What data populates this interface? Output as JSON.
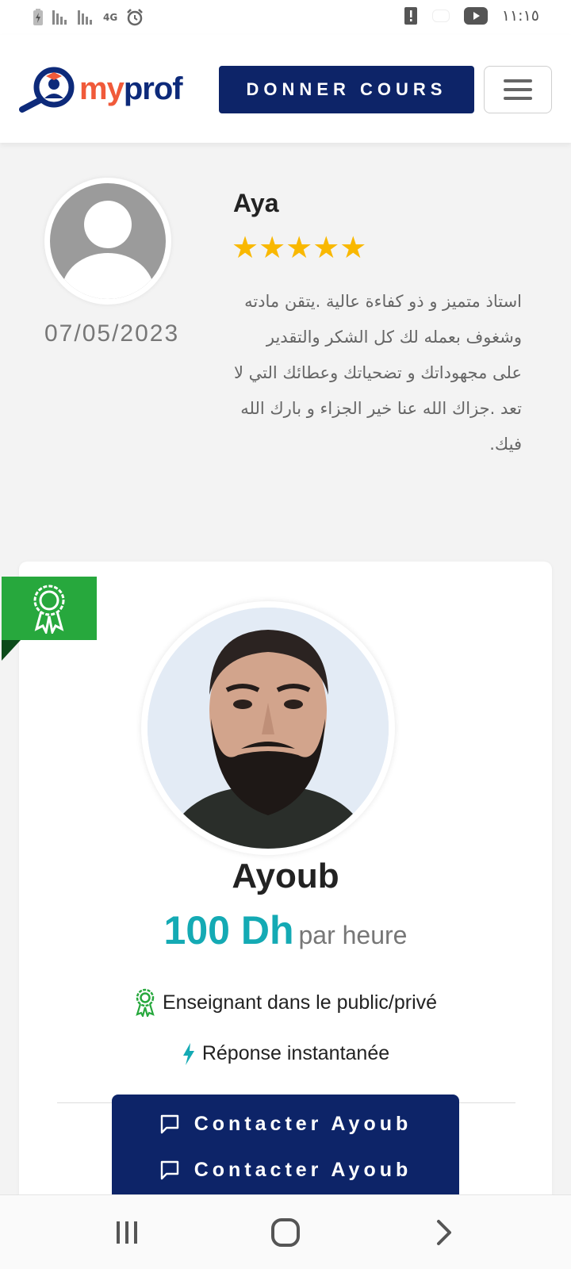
{
  "status_bar": {
    "time": "١١:١٥",
    "network": "4G",
    "icons": [
      "battery-charging-icon",
      "signal-icon",
      "signal-icon",
      "alarm-icon",
      "alert-icon",
      "youtube-icon"
    ]
  },
  "header": {
    "logo_my": "my",
    "logo_prof": "prof",
    "cta_label": "DONNER COURS",
    "menu_icon": "hamburger-icon"
  },
  "review": {
    "name": "Aya",
    "rating": 5,
    "stars": "★★★★★",
    "date": "07/05/2023",
    "text": "استاذ متميز و ذو كفاءة عالية .يتقن مادته وشغوف بعمله لك كل الشكر والتقدير على مجهوداتك و تضحياتك وعطائك التي لا تعد .جزاك الله عنا خير الجزاء و بارك الله فيك."
  },
  "tutor": {
    "name": "Ayoub",
    "price": "100 Dh",
    "price_unit": "par heure",
    "badge_icon": "award-ribbon-icon",
    "features": [
      {
        "icon": "award-icon",
        "label": "Enseignant dans le public/privé"
      },
      {
        "icon": "lightning-icon",
        "label": "Réponse instantanée"
      }
    ],
    "contact_buttons": [
      {
        "icon": "chat-icon",
        "label": "Contacter Ayoub"
      },
      {
        "icon": "chat-icon",
        "label": "Contacter Ayoub"
      }
    ]
  },
  "colors": {
    "brand_navy": "#0d2468",
    "brand_orange": "#f05a3a",
    "price_teal": "#14aab4",
    "star_gold": "#f9b800",
    "badge_green": "#27a83d"
  },
  "nav_bar": [
    "recent-apps-icon",
    "home-icon",
    "back-icon"
  ]
}
